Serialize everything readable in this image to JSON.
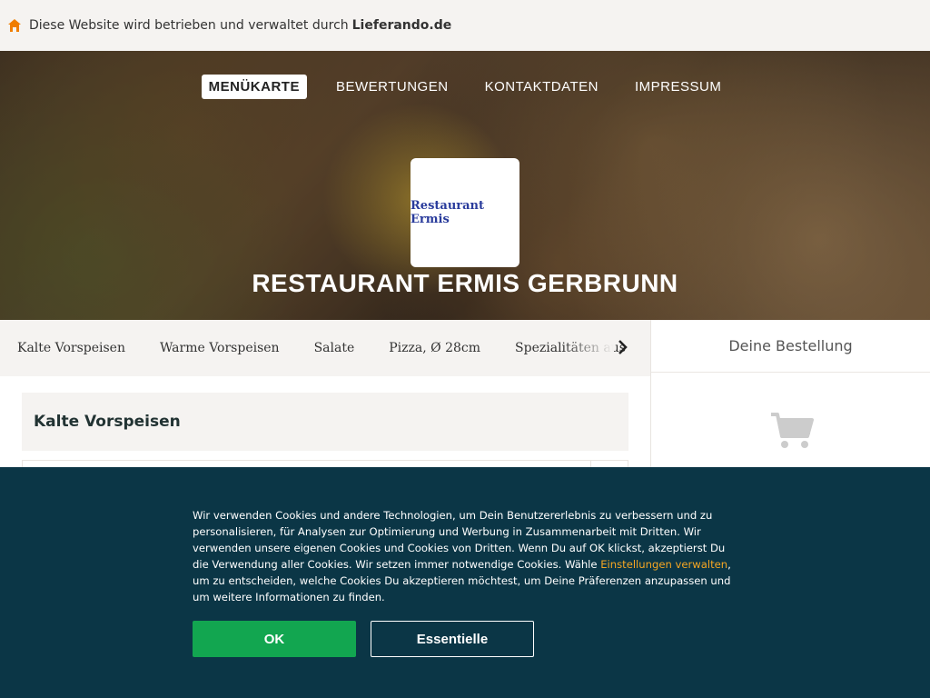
{
  "topbar": {
    "text": "Diese Website wird betrieben und verwaltet durch",
    "brand": "Lieferando.de"
  },
  "nav": {
    "items": [
      "MENÜKARTE",
      "BEWERTUNGEN",
      "KONTAKTDATEN",
      "IMPRESSUM"
    ],
    "active": "MENÜKARTE"
  },
  "restaurant": {
    "logo_text": "Restaurant Ermis",
    "title": "RESTAURANT ERMIS GERBRUNN"
  },
  "categories": [
    "Kalte Vorspeisen",
    "Warme Vorspeisen",
    "Salate",
    "Pizza, Ø 28cm",
    "Spezialitäten aus"
  ],
  "order": {
    "heading": "Deine Bestellung"
  },
  "menu": {
    "section_title": "Kalte Vorspeisen"
  },
  "cookie": {
    "text_before": "Wir verwenden Cookies und andere Technologien, um Dein Benutzererlebnis zu verbessern und zu personalisieren, für Analysen zur Optimierung und Werbung in Zusammenarbeit mit Dritten. Wir verwenden unsere eigenen Cookies und Cookies von Dritten. Wenn Du auf OK klickst, akzeptierst Du die Verwendung aller Cookies. Wir setzen immer notwendige Cookies. Wähle ",
    "link": "Einstellungen verwalten",
    "text_after": ", um zu entscheiden, welche Cookies Du akzeptieren möchtest, um Deine Präferenzen anzupassen und um weitere Informationen zu finden.",
    "ok_label": "OK",
    "essential_label": "Essentielle"
  },
  "colors": {
    "brand_orange": "#f5a623",
    "cookie_bg": "#0b3646",
    "ok_green": "#12a650"
  },
  "icons": [
    "house-icon",
    "chevron-right-icon",
    "cart-icon"
  ]
}
